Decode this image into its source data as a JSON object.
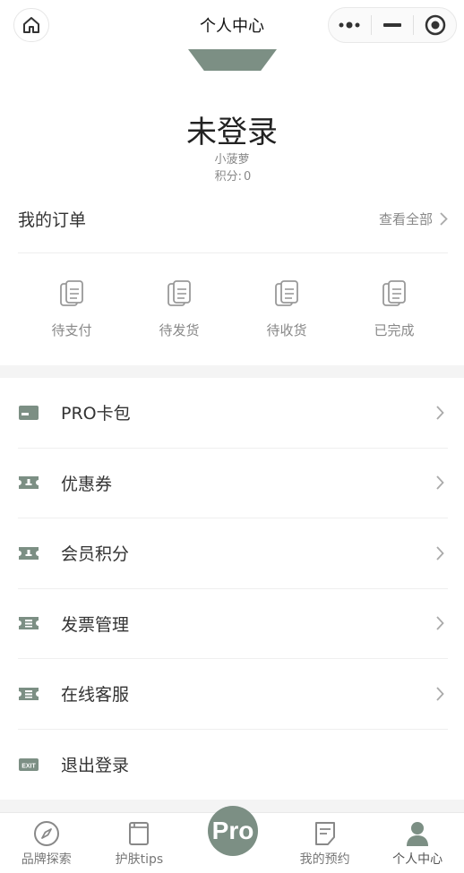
{
  "navbar": {
    "title": "个人中心",
    "home_icon": "home-icon",
    "capsule": [
      "more-icon",
      "minimize-icon",
      "close-target-icon"
    ]
  },
  "profile": {
    "name": "未登录",
    "nickname": "小菠萝",
    "points_label": "积分:",
    "points_value": "0"
  },
  "orders": {
    "title": "我的订单",
    "view_all": "查看全部",
    "statuses": [
      {
        "label": "待支付",
        "icon": "document-icon"
      },
      {
        "label": "待发货",
        "icon": "document-icon"
      },
      {
        "label": "待收货",
        "icon": "document-icon"
      },
      {
        "label": "已完成",
        "icon": "document-icon"
      }
    ]
  },
  "menu": [
    {
      "label": "PRO卡包",
      "icon": "card-icon",
      "arrow": true
    },
    {
      "label": "优惠券",
      "icon": "ticket-icon",
      "arrow": true
    },
    {
      "label": "会员积分",
      "icon": "ticket-icon",
      "arrow": true
    },
    {
      "label": "发票管理",
      "icon": "invoice-icon",
      "arrow": true
    },
    {
      "label": "在线客服",
      "icon": "service-icon",
      "arrow": true
    },
    {
      "label": "退出登录",
      "icon": "exit-icon",
      "arrow": false,
      "icon_text": "EXIT"
    }
  ],
  "tabbar": [
    {
      "label": "品牌探索",
      "icon": "compass-icon"
    },
    {
      "label": "护肤tips",
      "icon": "book-icon"
    },
    {
      "label": "Pro",
      "icon": "pro-logo"
    },
    {
      "label": "我的预约",
      "icon": "note-icon"
    },
    {
      "label": "个人中心",
      "icon": "user-icon",
      "active": true
    }
  ],
  "colors": {
    "accent": "#7c8f84",
    "text": "#333333",
    "muted": "#888888",
    "band": "#f4f4f4"
  }
}
